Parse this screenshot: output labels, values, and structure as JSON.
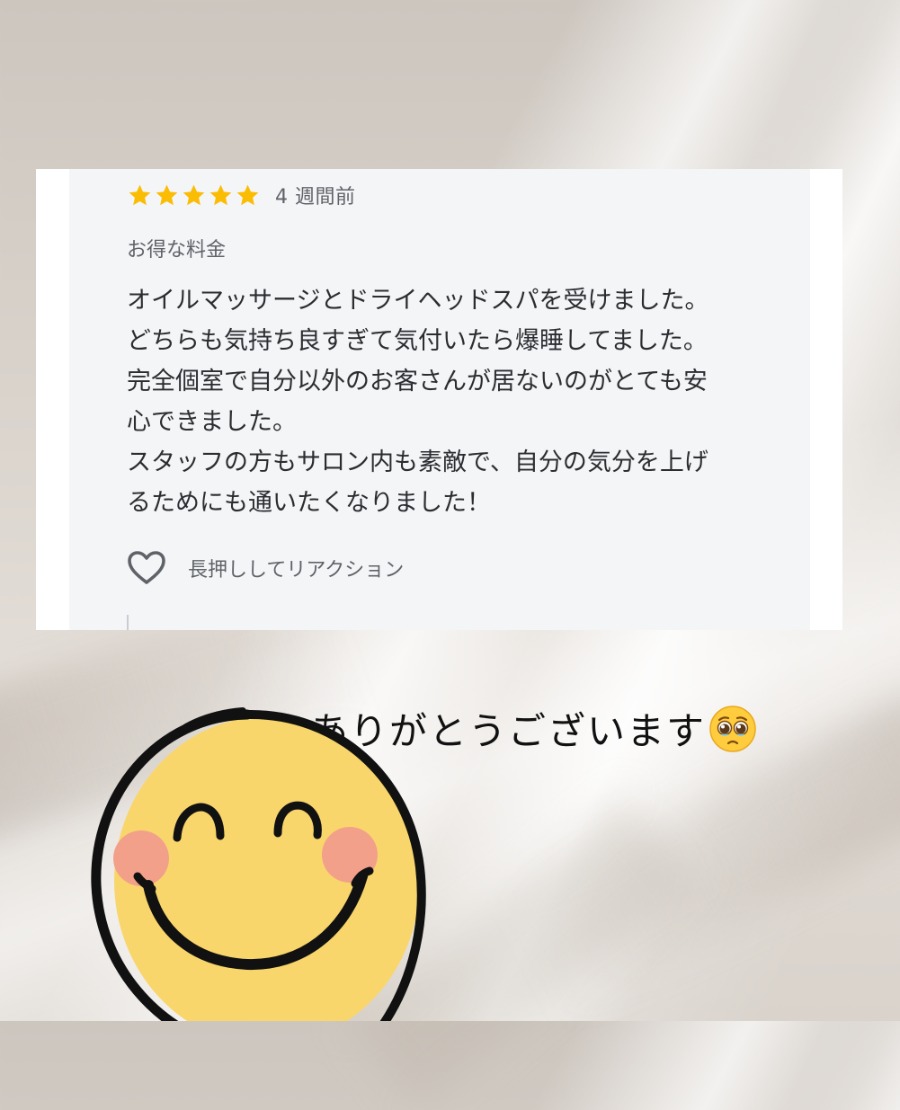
{
  "review": {
    "rating": 5,
    "rating_max": 5,
    "star_color": "#fbbc04",
    "time_ago": "4 週間前",
    "subtitle": "お得な料金",
    "body_lines": [
      "オイルマッサージとドライヘッドスパを受けました。",
      "どちらも気持ち良すぎて気付いたら爆睡してました。",
      "完全個室で自分以外のお客さんが居ないのがとても安",
      "心できました。",
      "スタッフの方もサロン内も素敵で、自分の気分を上げ",
      "るためにも通いたくなりました！"
    ],
    "reaction_label": "長押ししてリアクション",
    "reaction_icon": "heart-outline-icon"
  },
  "caption": {
    "text": "ありがとうございます",
    "emoji_icon": "pleading-face-icon"
  },
  "illustration": {
    "icon": "smiley-face-icon",
    "face_color": "#f9d66b",
    "cheek_color": "#f2a08a",
    "outline_color": "#111111"
  }
}
